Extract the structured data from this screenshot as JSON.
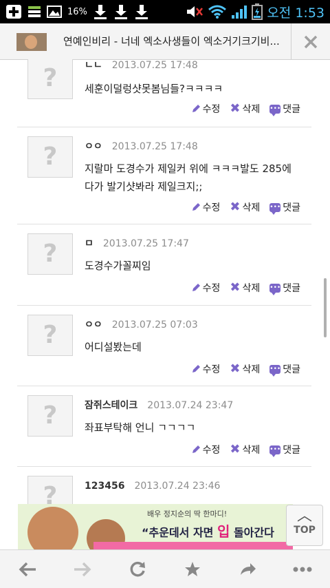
{
  "status_bar": {
    "battery_percent": "16%",
    "time": "오전 1:53",
    "icons": [
      "plus-box-icon",
      "stack-icon",
      "image-icon",
      "download-icon",
      "download-icon",
      "download-icon",
      "mute-icon",
      "wifi-icon",
      "signal-icon",
      "battery-icon"
    ]
  },
  "browser": {
    "page_title": "연예인비리 - 너네 엑소사생들이 엑소거기크기비..."
  },
  "comments": [
    {
      "author": "ㄴㄴ",
      "date": "2013.07.25 17:48",
      "lines": [
        "세훈이덜렁샷못봄님들?ㅋㅋㅋㅋ"
      ]
    },
    {
      "author": "ㅇㅇ",
      "date": "2013.07.25 17:48",
      "lines": [
        "지랄마 도경수가 제일커 위에 ㅋㅋㅋ발도 285에",
        "다가 발기샷봐라 제일크지;;"
      ]
    },
    {
      "author": "ㅁ",
      "date": "2013.07.25 17:47",
      "lines": [
        "도경수가꼴찌임"
      ]
    },
    {
      "author": "ㅇㅇ",
      "date": "2013.07.25 07:03",
      "lines": [
        "어디설봤는데"
      ]
    },
    {
      "author": "잠쥐스테이크",
      "date": "2013.07.24 23:47",
      "lines": [
        "좌표부탁해 언니 ㄱㄱㄱㄱ"
      ]
    },
    {
      "author": "123456",
      "date": "2013.07.24 23:46",
      "lines": []
    }
  ],
  "actions": {
    "edit": "수정",
    "delete": "삭제",
    "reply": "댓글"
  },
  "avatar_placeholder": "?",
  "ad": {
    "small_text": "배우 정지순의 딱 한마디!",
    "big_text_a": "“추운데서 자면 ",
    "big_text_hl": "입",
    "big_text_b": " 돌아간다"
  },
  "top_button": "TOP",
  "bottom_bar": [
    "back-icon",
    "forward-icon",
    "reload-icon",
    "bookmark-star-icon",
    "share-icon",
    "more-icon"
  ]
}
